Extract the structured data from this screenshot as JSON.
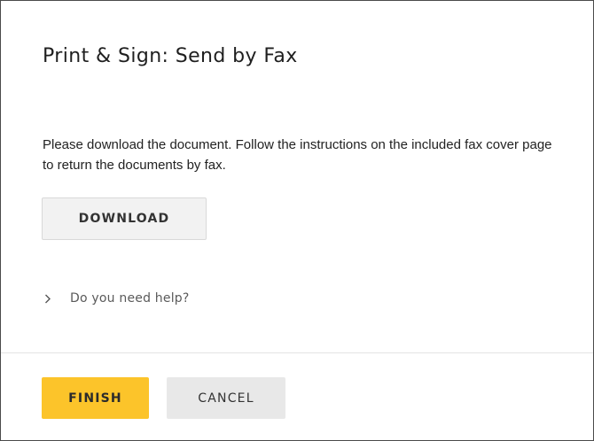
{
  "dialog": {
    "title": "Print & Sign: Send by Fax",
    "instructions": "Please download the document. Follow the instructions on the included fax cover page to return the documents by fax.",
    "download_label": "DOWNLOAD",
    "help_label": "Do you need help?",
    "help_icon": "chevron-right-icon"
  },
  "footer": {
    "finish_label": "FINISH",
    "cancel_label": "CANCEL"
  },
  "colors": {
    "accent": "#fcc42a",
    "secondary_button": "#e8e8e8",
    "border": "#4a4a4a"
  }
}
